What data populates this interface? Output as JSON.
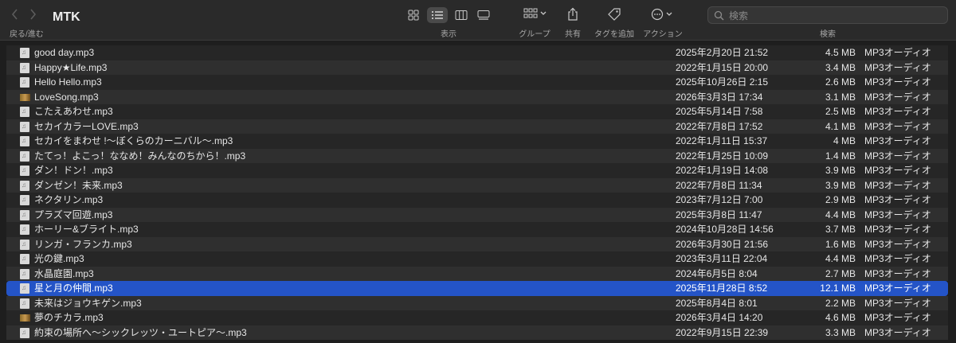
{
  "toolbar": {
    "title": "MTK",
    "nav_label": "戻る/進む",
    "view_label": "表示",
    "group_label": "グループ",
    "share_label": "共有",
    "tag_label": "タグを追加",
    "action_label": "アクション",
    "search_label": "検索",
    "search_placeholder": "検索"
  },
  "files": [
    {
      "name": "good day.mp3",
      "date": "2025年2月20日 21:52",
      "size": "4.5 MB",
      "kind": "MP3オーディオ",
      "icon": "doc"
    },
    {
      "name": "Happy★Life.mp3",
      "date": "2022年1月15日 20:00",
      "size": "3.4 MB",
      "kind": "MP3オーディオ",
      "icon": "doc"
    },
    {
      "name": "Hello Hello.mp3",
      "date": "2025年10月26日 2:15",
      "size": "2.6 MB",
      "kind": "MP3オーディオ",
      "icon": "doc"
    },
    {
      "name": "LoveSong.mp3",
      "date": "2026年3月3日 17:34",
      "size": "3.1 MB",
      "kind": "MP3オーディオ",
      "icon": "thumb"
    },
    {
      "name": "こたえあわせ.mp3",
      "date": "2025年5月14日 7:58",
      "size": "2.5 MB",
      "kind": "MP3オーディオ",
      "icon": "doc"
    },
    {
      "name": "セカイカラーLOVE.mp3",
      "date": "2022年7月8日 17:52",
      "size": "4.1 MB",
      "kind": "MP3オーディオ",
      "icon": "doc"
    },
    {
      "name": "セカイをまわせ !〜ぼくらのカーニバル〜.mp3",
      "date": "2022年1月11日 15:37",
      "size": "4 MB",
      "kind": "MP3オーディオ",
      "icon": "doc"
    },
    {
      "name": "たてっ！よこっ！ななめ！みんなのちから！.mp3",
      "date": "2022年1月25日 10:09",
      "size": "1.4 MB",
      "kind": "MP3オーディオ",
      "icon": "doc"
    },
    {
      "name": "ダン！ドン！.mp3",
      "date": "2022年1月19日 14:08",
      "size": "3.9 MB",
      "kind": "MP3オーディオ",
      "icon": "doc"
    },
    {
      "name": "ダンゼン！未来.mp3",
      "date": "2022年7月8日 11:34",
      "size": "3.9 MB",
      "kind": "MP3オーディオ",
      "icon": "doc"
    },
    {
      "name": "ネクタリン.mp3",
      "date": "2023年7月12日 7:00",
      "size": "2.9 MB",
      "kind": "MP3オーディオ",
      "icon": "doc"
    },
    {
      "name": "プラズマ回遊.mp3",
      "date": "2025年3月8日 11:47",
      "size": "4.4 MB",
      "kind": "MP3オーディオ",
      "icon": "doc"
    },
    {
      "name": "ホーリー&ブライト.mp3",
      "date": "2024年10月28日 14:56",
      "size": "3.7 MB",
      "kind": "MP3オーディオ",
      "icon": "doc"
    },
    {
      "name": "リンガ・フランカ.mp3",
      "date": "2026年3月30日 21:56",
      "size": "1.6 MB",
      "kind": "MP3オーディオ",
      "icon": "doc"
    },
    {
      "name": "光の鍵.mp3",
      "date": "2023年3月11日 22:04",
      "size": "4.4 MB",
      "kind": "MP3オーディオ",
      "icon": "doc"
    },
    {
      "name": "水晶庭園.mp3",
      "date": "2024年6月5日 8:04",
      "size": "2.7 MB",
      "kind": "MP3オーディオ",
      "icon": "doc"
    },
    {
      "name": "星と月の仲間.mp3",
      "date": "2025年11月28日 8:52",
      "size": "12.1 MB",
      "kind": "MP3オーディオ",
      "icon": "doc",
      "selected": true
    },
    {
      "name": "未来はジョウキゲン.mp3",
      "date": "2025年8月4日 8:01",
      "size": "2.2 MB",
      "kind": "MP3オーディオ",
      "icon": "doc"
    },
    {
      "name": "夢のチカラ.mp3",
      "date": "2026年3月4日 14:20",
      "size": "4.6 MB",
      "kind": "MP3オーディオ",
      "icon": "thumb"
    },
    {
      "name": "約束の場所へ〜シックレッツ・ユートピア〜.mp3",
      "date": "2022年9月15日 22:39",
      "size": "3.3 MB",
      "kind": "MP3オーディオ",
      "icon": "doc"
    }
  ]
}
